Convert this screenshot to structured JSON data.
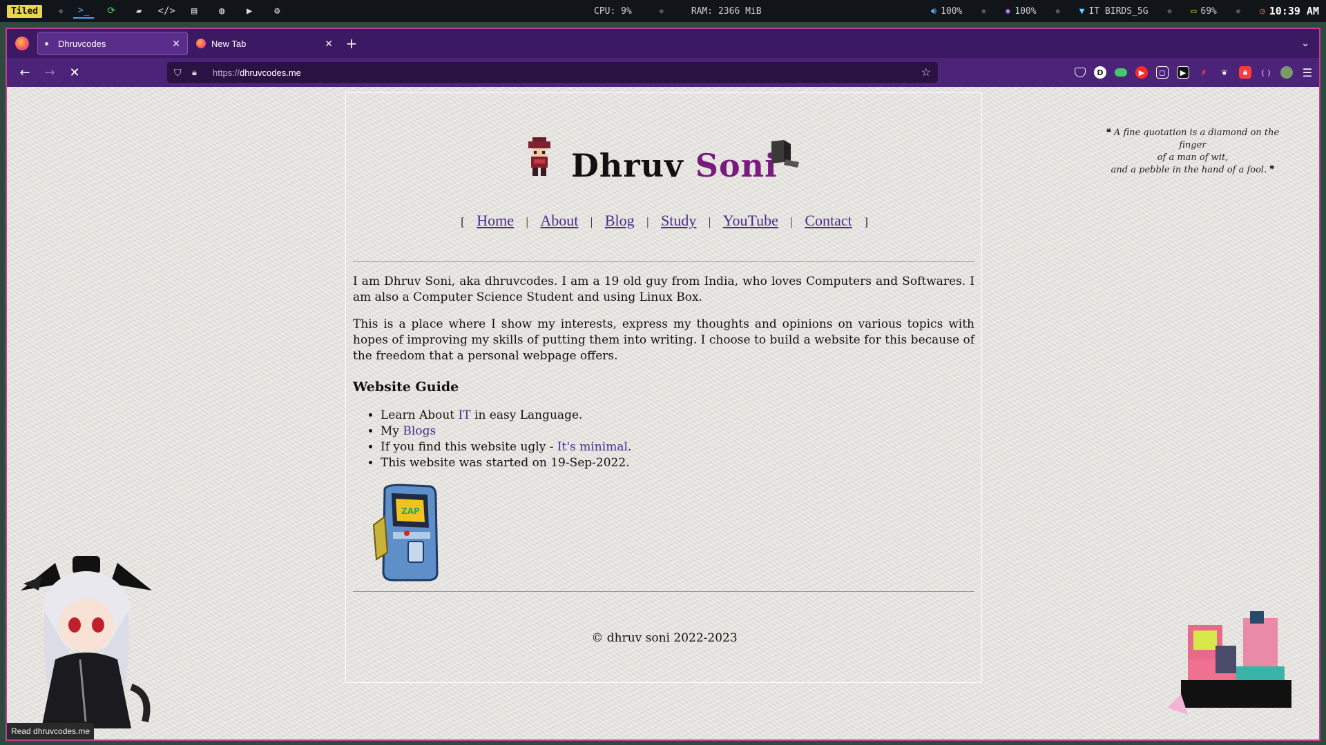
{
  "system_bar": {
    "workspace_mode": "Tiled",
    "cpu": "CPU:  9%",
    "ram": "RAM: 2366 MiB",
    "volume": "100%",
    "brightness": "100%",
    "wifi": "IT BIRDS_5G",
    "battery": "69%",
    "clock": "10:39 AM",
    "launcher_icons": [
      "terminal-icon",
      "refresh-icon",
      "folder-icon",
      "code-icon",
      "notes-icon",
      "chat-icon",
      "youtube-icon",
      "settings-icon"
    ]
  },
  "browser": {
    "tabs": [
      {
        "title": "Dhruvcodes",
        "active": true
      },
      {
        "title": "New Tab",
        "active": false
      }
    ],
    "url_scheme": "https://",
    "url_host": "dhruvcodes.me",
    "status_tooltip": "Read dhruvcodes.me",
    "extension_colors": [
      "#ffffff",
      "#ffffff",
      "#42c96a",
      "#ff2a2a",
      "#ffffff",
      "#111111",
      "#c01a1a",
      "#ffffff",
      "#ff3b3b",
      "#c77bff",
      "#7a9a6a"
    ]
  },
  "page": {
    "quote_line1": "A fine quotation is a diamond on the finger",
    "quote_line2": "of a man of wit,",
    "quote_line3": "and a pebble in the hand of a fool.",
    "title_first": "Dhruv",
    "title_last": "Soni",
    "nav": {
      "open_bracket": "[",
      "close_bracket": "]",
      "separator": "|",
      "home": "Home",
      "about": "About",
      "blog": "Blog",
      "study": "Study",
      "youtube": "YouTube",
      "contact": "Contact"
    },
    "intro_1": "I am Dhruv Soni, aka dhruvcodes. I am a 19 old guy from India, who loves Computers and Softwares. I am also a Computer Science Student and using Linux Box.",
    "intro_2": "This is a place where I show my interests, express my thoughts and opinions on various topics with hopes of improving my skills of putting them into writing. I choose to build a website for this because of the freedom that a personal webpage offers.",
    "guide_heading": "Website Guide",
    "guide": {
      "item1_pre": "Learn About ",
      "item1_link": "IT",
      "item1_post": " in easy Language.",
      "item2_pre": "My ",
      "item2_link": "Blogs",
      "item3_pre": "If you find this website ugly - ",
      "item3_link": "It's minimal",
      "item3_post": ".",
      "item4": "This website was started on 19-Sep-2022."
    },
    "footer": "© dhruv soni 2022-2023",
    "colors": {
      "surname": "#7a1a7e",
      "link": "#4a2a8c"
    }
  }
}
